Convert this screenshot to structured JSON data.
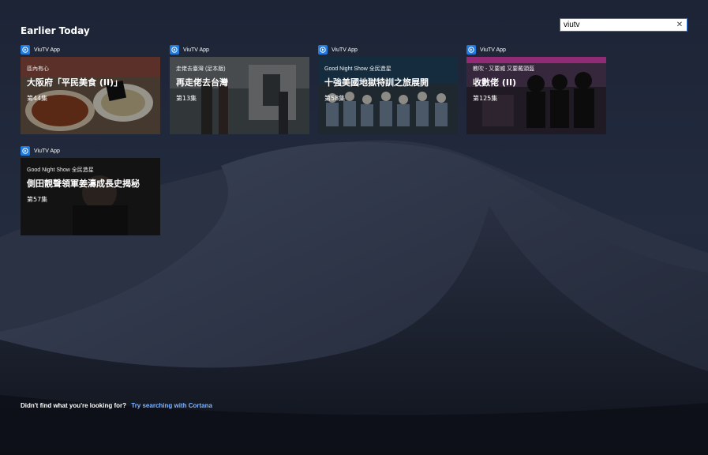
{
  "section_title": "Earlier Today",
  "search": {
    "value": "viutv",
    "clear_icon": "close-icon"
  },
  "tiles": [
    {
      "app": "ViuTV App",
      "subtitle": "區內有心",
      "title": "大阪府「平民美食 (II)」",
      "episode": "第44集"
    },
    {
      "app": "ViuTV App",
      "subtitle": "走佬去臺灣 (足本版)",
      "title": "再走佬去台灣",
      "episode": "第13集"
    },
    {
      "app": "ViuTV App",
      "subtitle": "Good Night Show 全民造星",
      "title": "十強美國地獄特訓之旅展開",
      "episode": "第58集"
    },
    {
      "app": "ViuTV App",
      "subtitle": "教吹 - 又要威 又要戴頭盔",
      "title": "收數佬 (II)",
      "episode": "第125集"
    },
    {
      "app": "ViuTV App",
      "subtitle": "Good Night Show 全民造星",
      "title": "側田靚聲領軍姜濤成長史揭秘",
      "episode": "第57集"
    }
  ],
  "footer": {
    "question": "Didn't find what you're looking for?",
    "link": "Try searching with Cortana"
  }
}
